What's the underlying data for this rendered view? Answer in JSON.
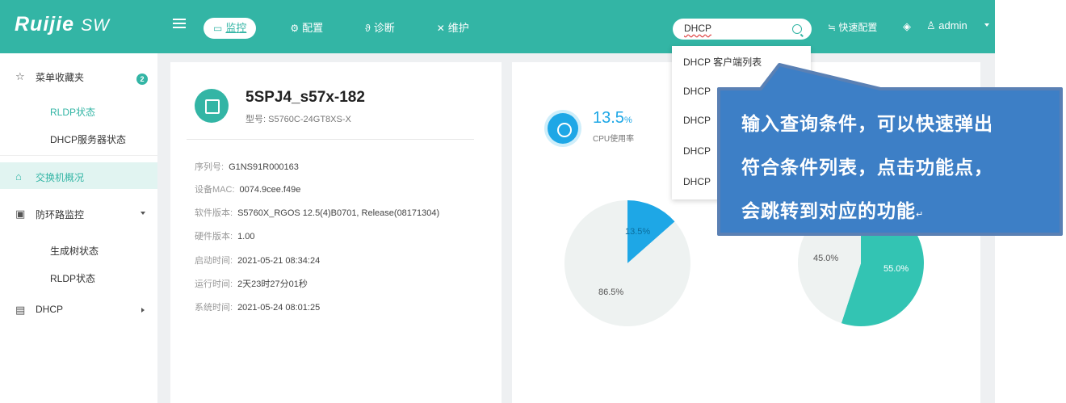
{
  "header": {
    "logo_brand": "Ruijie",
    "logo_product": "SW",
    "tabs": [
      {
        "label": "监控",
        "icon": "monitor-icon",
        "active": true
      },
      {
        "label": "配置",
        "icon": "gear-icon",
        "active": false
      },
      {
        "label": "诊断",
        "icon": "stethoscope-icon",
        "active": false
      },
      {
        "label": "维护",
        "icon": "tools-icon",
        "active": false
      }
    ],
    "search": {
      "value": "DHCP"
    },
    "quick_config": "快速配置",
    "user": "admin",
    "brand_color": "#33b5a5"
  },
  "search_dropdown": {
    "items": [
      "DHCP 客户端列表",
      "DHCP",
      "DHCP",
      "DHCP",
      "DHCP"
    ]
  },
  "sidebar": {
    "favorites": {
      "label": "菜单收藏夹",
      "count": "2"
    },
    "favorite_items": [
      "RLDP状态",
      "DHCP服务器状态"
    ],
    "switch_overview": "交换机概况",
    "loop_monitor": "防环路监控",
    "loop_items": [
      "生成树状态",
      "RLDP状态"
    ],
    "dhcp": "DHCP"
  },
  "device": {
    "name": "5SPJ4_s57x-182",
    "model": "型号: S5760C-24GT8XS-X",
    "info": [
      {
        "label": "序列号:",
        "value": "G1NS91R000163"
      },
      {
        "label": "设备MAC:",
        "value": "0074.9cee.f49e"
      },
      {
        "label": "软件版本:",
        "value": "S5760X_RGOS 12.5(4)B0701, Release(08171304)"
      },
      {
        "label": "硬件版本:",
        "value": "1.00"
      },
      {
        "label": "启动时间:",
        "value": "2021-05-21 08:34:24"
      },
      {
        "label": "运行时间:",
        "value": "2天23时27分01秒"
      },
      {
        "label": "系统时间:",
        "value": "2021-05-24 08:01:25"
      }
    ]
  },
  "cpu": {
    "value": "13.5",
    "unit": "%",
    "label": "CPU使用率"
  },
  "pies": {
    "cpu_pie": {
      "slices": [
        {
          "label": "13.5%",
          "value": 13.5,
          "color": "#1ea7e6"
        },
        {
          "label": "86.5%",
          "value": 86.5,
          "color": "#eef2f1"
        }
      ]
    },
    "mem_pie": {
      "slices": [
        {
          "label": "55.0%",
          "value": 55.0,
          "color": "#33c4b3"
        },
        {
          "label": "45.0%",
          "value": 45.0,
          "color": "#eef2f1"
        }
      ]
    }
  },
  "callout": {
    "lines": [
      "输入查询条件，可以快速弹出",
      "符合条件列表，点击功能点，",
      "会跳转到对应的功能"
    ],
    "mark": "↵",
    "fill": "#3d7fc6",
    "stroke": "#5a80b4"
  }
}
